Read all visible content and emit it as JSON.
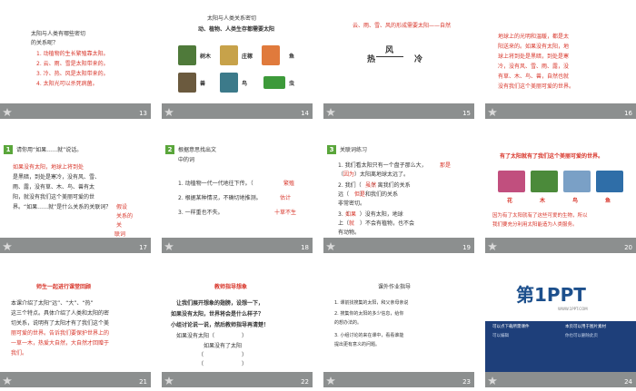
{
  "window": {
    "title": "太阳ppt slides"
  },
  "slides": [
    {
      "num": "13",
      "lines": [
        "太阳与人类有哪些密切",
        "的关系呢？",
        "1. 动植物的生长繁殖靠太阳。",
        "2. 云、雨、雪是太阳带来的。",
        "3. 冷、热、风是太阳带来的。",
        "4. 太阳光可以杀死病菌。"
      ]
    },
    {
      "num": "14",
      "title": "太阳与人类关系密切",
      "subtitle": "动、植物、人类生存都需要太阳",
      "labels": [
        "树木",
        "庄稼",
        "鱼",
        "兽",
        "鸟",
        "虫"
      ]
    },
    {
      "num": "15",
      "title": "云、雨、雪、风的形成需要太阳——自然",
      "words": [
        "风",
        "热",
        "冷"
      ]
    },
    {
      "num": "16",
      "lines": [
        "地球上的光明和温暖，都是太",
        "阳送来的。如果没有太阳，地",
        "球上将到处是黑暗，到处是寒",
        "冷，没有风、雪、雨、露，没",
        "有草、木、鸟、兽，自然也就",
        "没有我们这个美丽可爱的世界。"
      ]
    },
    {
      "num": "17",
      "badge": "1",
      "title": "请你用“如果……就”说话。",
      "lines": [
        "如果没有太阳，地球上将到处",
        "是黑暗，到处是寒冷，没有风、雪、",
        "雨、露，没有草、木、鸟、兽有太",
        "阳，就没有我们这个美丽可爱的世",
        "界。“如果……就”是什么关系的关联词？"
      ],
      "notes": [
        "假设",
        "关系的",
        "关",
        "联词"
      ]
    },
    {
      "num": "18",
      "badge": "2",
      "title": "根据意思找出文",
      "title2": "中的词",
      "lines": [
        "1. 动植物一代一代地往下传。（",
        "2. 根据某种情况，不确切地推测。",
        "3. 一样重也不失。"
      ],
      "answers": [
        "繁殖",
        "估计",
        "十草不生"
      ]
    },
    {
      "num": "19",
      "badge": "3",
      "title": "关联词练习",
      "lines": [
        "1. 我们看太阳只有一个盘子那么大，",
        "（　　）太阳离地球太远了。",
        "2. 我们（　　）离我们的关系",
        "远（　　）和我们的关系",
        "非常密切。",
        "3.（　　）没有太阳，地球",
        "上（　　）不会有植物，也不会",
        "有动物。"
      ],
      "answers": [
        "那是",
        "因为",
        "虽然",
        "但是",
        "如果",
        "就"
      ]
    },
    {
      "num": "20",
      "title": "有了太阳就有了我们这个美丽可爱的世界。",
      "labels": [
        "花",
        "木",
        "鸟",
        "鱼"
      ],
      "lines": [
        "因为有了太阳就有了这些可爱的生物，所以",
        "我们要充分利用太阳能造为人类服务。"
      ]
    },
    {
      "num": "21",
      "title": "师生一起进行课堂回顾",
      "lines": [
        "本课介绍了太阳“远”、“大”、“热”",
        "这三个特点。具体介绍了人类和太阳的密",
        "切关系，说明有了太阳才有了我们这个美",
        "丽可爱的世界。告诉我们要保护世界上的",
        "一草一木，热爱大自然，大自然才回赠于",
        "我们。"
      ]
    },
    {
      "num": "22",
      "title": "教师指导想象",
      "lines": [
        "让我们展开想象的翅膀，设想一下，",
        "如果没有太阳，世界将会是什么样子？",
        "小组讨论说一说，然后教师指导再清楚！",
        "如果没有太阳（　　　　　）",
        "如果没有了太阳",
        "（　　　　　　　）",
        "（　　　　　　　）"
      ]
    },
    {
      "num": "23",
      "title": "课外作业指导",
      "lines": [
        "1. 课前找搜集的太阳，和父亲母亲说",
        "2. 搜集你的太阳的多少信息，给你",
        "的想办法的。",
        "3. 小组讨论的来在课中，看看谁能",
        "提出更有意义的问题。"
      ]
    },
    {
      "num": "24",
      "brand": "第1PPT",
      "brand_sub": "WWW.1PPT.COM",
      "lines": [
        "可以点下载所需课件",
        "本页可以用于图片素材",
        "可以编辑",
        "你也可以删除此页"
      ]
    }
  ]
}
